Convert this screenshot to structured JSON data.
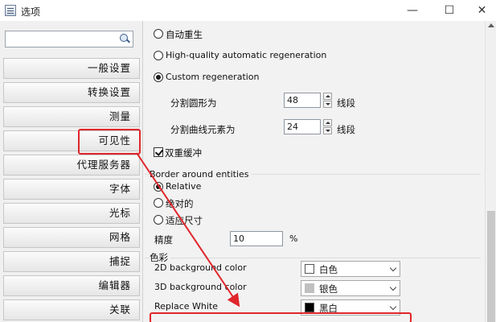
{
  "window": {
    "title": "选项",
    "min": "—",
    "max": "☐",
    "close": "✕"
  },
  "search": {
    "placeholder": ""
  },
  "nav": {
    "items": [
      {
        "label": "一般设置"
      },
      {
        "label": "转换设置"
      },
      {
        "label": "测量"
      },
      {
        "label": "可见性"
      },
      {
        "label": "代理服务器"
      },
      {
        "label": "字体"
      },
      {
        "label": "光标"
      },
      {
        "label": "网格"
      },
      {
        "label": "捕捉"
      },
      {
        "label": "编辑器"
      },
      {
        "label": "关联"
      }
    ]
  },
  "regen": {
    "auto": "自动重生",
    "hq": "High-quality automatic regeneration",
    "custom": "Custom regeneration",
    "circle_label": "分割圆形为",
    "circle_value": "48",
    "circle_unit": "线段",
    "curve_label": "分割曲线元素为",
    "curve_value": "24",
    "curve_unit": "线段",
    "double_buffer": "双重缓冲"
  },
  "border": {
    "title": "Border around entities",
    "relative": "Relative",
    "absolute": "绝对的",
    "adaptive": "适应尺寸",
    "precision_label": "精度",
    "precision_value": "10",
    "precision_unit": "%"
  },
  "colors": {
    "title": "色彩",
    "bg2d_label": "2D background color",
    "bg2d_value": "白色",
    "bg3d_label": "3D background color",
    "bg3d_value": "银色",
    "replace_label": "Replace White",
    "replace_value": "黑白"
  },
  "swatches": {
    "white": "#ffffff",
    "silver": "#c0c0c0",
    "black": "#000000"
  },
  "accent": {
    "annotation_red": "#e0262b"
  }
}
